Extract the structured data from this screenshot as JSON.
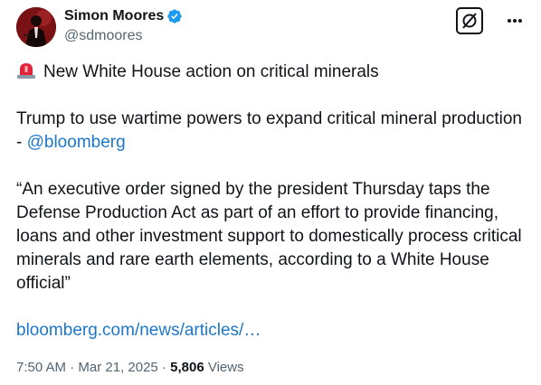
{
  "author": {
    "display_name": "Simon Moores",
    "handle": "@sdmoores",
    "verified": true,
    "avatar_icon": "avatar-photo"
  },
  "actions": {
    "grok_icon": "grok-icon",
    "more_icon": "more-dots-icon"
  },
  "tweet": {
    "headline_emoji": "siren-emoji",
    "headline": "New White House action on critical minerals",
    "summary_text": "Trump to use wartime powers to expand critical mineral production - ",
    "summary_mention": "@bloomberg",
    "quote": "“An executive order signed by the president Thursday taps the Defense Production Act as part of an effort to provide financing, loans and other investment support to domestically process critical minerals and rare earth elements, according to a White House official”",
    "link": "bloomberg.com/news/articles/…"
  },
  "meta": {
    "time": "7:50 AM",
    "separator": " · ",
    "date": "Mar 21, 2025",
    "separator2": " · ",
    "views_count": "5,806",
    "views_label": " Views"
  },
  "colors": {
    "text": "#0f1419",
    "secondary": "#536471",
    "link": "#1d77c9",
    "verified": "#1d9bf0"
  }
}
